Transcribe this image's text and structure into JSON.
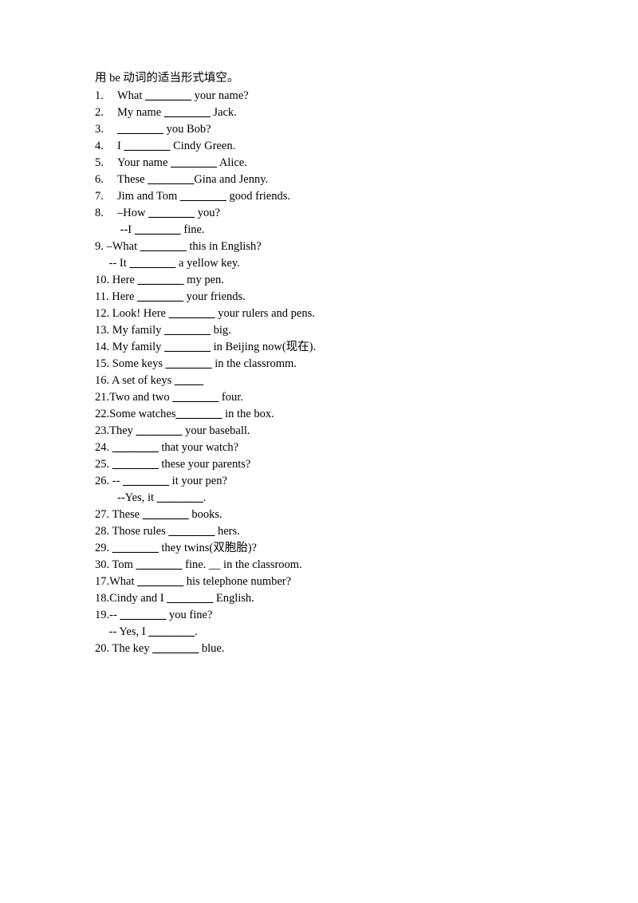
{
  "document": {
    "heading": "用 be 动词的适当形式填空。",
    "blank_long": "________",
    "blank_short": "_____",
    "blank_tiny": "__",
    "lines": [
      {
        "id": "q1",
        "style": "tabbed",
        "num": "1.",
        "before": "What ",
        "blank": "long",
        "after": " your name?"
      },
      {
        "id": "q2",
        "style": "tabbed",
        "num": "2.",
        "before": "My name ",
        "blank": "long",
        "after": " Jack."
      },
      {
        "id": "q3",
        "style": "tabbed",
        "num": "3.",
        "before": "",
        "blank": "long",
        "after": " you Bob?"
      },
      {
        "id": "q4",
        "style": "tabbed",
        "num": "4.",
        "before": "I ",
        "blank": "long",
        "after": " Cindy Green."
      },
      {
        "id": "q5",
        "style": "tabbed",
        "num": "5.",
        "before": "Your name ",
        "blank": "long",
        "after": " Alice."
      },
      {
        "id": "q6",
        "style": "tabbed",
        "num": "6.",
        "before": "These ",
        "blank": "long",
        "after": "Gina and Jenny."
      },
      {
        "id": "q7",
        "style": "tabbed",
        "num": "7.",
        "before": "Jim and Tom ",
        "blank": "long",
        "after": " good friends."
      },
      {
        "id": "q8",
        "style": "tabbed",
        "num": "8.",
        "before": "–How ",
        "blank": "long",
        "after": " you?"
      },
      {
        "id": "q8a",
        "style": "cont",
        "num": "",
        "before": " --I ",
        "blank": "long",
        "after": " fine."
      },
      {
        "id": "q9",
        "style": "plain",
        "num": "9.",
        "before": " –What ",
        "blank": "long",
        "after": " this in English?"
      },
      {
        "id": "q9a",
        "style": "cont2",
        "num": "",
        "before": " -- It ",
        "blank": "long",
        "after": " a yellow key."
      },
      {
        "id": "q10",
        "style": "plain",
        "num": "10.",
        "before": " Here ",
        "blank": "long",
        "after": " my pen."
      },
      {
        "id": "q11",
        "style": "plain",
        "num": "11.",
        "before": " Here ",
        "blank": "long",
        "after": " your friends."
      },
      {
        "id": "q12",
        "style": "plain",
        "num": "12.",
        "before": " Look! Here ",
        "blank": "long",
        "after": " your rulers and pens."
      },
      {
        "id": "q13",
        "style": "plain",
        "num": "13.",
        "before": " My family ",
        "blank": "long",
        "after": " big."
      },
      {
        "id": "q14",
        "style": "plain",
        "num": "14.",
        "before": " My family ",
        "blank": "long",
        "after": " in Beijing now(现在)."
      },
      {
        "id": "q15",
        "style": "plain",
        "num": "15.",
        "before": " Some keys ",
        "blank": "long",
        "after": " in the classromm."
      },
      {
        "id": "q16",
        "style": "plain",
        "num": "16.",
        "before": " A set of keys ",
        "blank": "short",
        "after": ""
      },
      {
        "id": "q21",
        "style": "plain",
        "num": "21.",
        "before": "Two and two ",
        "blank": "long",
        "after": " four."
      },
      {
        "id": "q22",
        "style": "plain",
        "num": "22.",
        "before": "Some watches",
        "blank": "long",
        "after": " in the box."
      },
      {
        "id": "q23",
        "style": "plain",
        "num": "23.",
        "before": "They ",
        "blank": "long",
        "after": " your baseball."
      },
      {
        "id": "q24",
        "style": "plain",
        "num": "24.",
        "before": " ",
        "blank": "long",
        "after": " that your watch?"
      },
      {
        "id": "q25",
        "style": "plain",
        "num": "25.",
        "before": " ",
        "blank": "long",
        "after": " these your parents?"
      },
      {
        "id": "q26",
        "style": "plain",
        "num": "26.",
        "before": " -- ",
        "blank": "long",
        "after": " it your pen?"
      },
      {
        "id": "q26a",
        "style": "cont",
        "num": "",
        "before": "--Yes, it ",
        "blank": "long",
        "after": "."
      },
      {
        "id": "q27",
        "style": "plain",
        "num": "27.",
        "before": " These ",
        "blank": "long",
        "after": " books."
      },
      {
        "id": "q28",
        "style": "plain",
        "num": "28.",
        "before": " Those rules ",
        "blank": "long",
        "after": " hers."
      },
      {
        "id": "q29",
        "style": "plain",
        "num": "29.",
        "before": " ",
        "blank": "long",
        "after": " they twins(双胞胎)?"
      },
      {
        "id": "q30",
        "style": "plain",
        "num": "30.",
        "before": " Tom ",
        "blank": "long",
        "after": " fine. __ in the classroom."
      },
      {
        "id": "q17",
        "style": "plain",
        "num": "17.",
        "before": "What ",
        "blank": "long",
        "after": " his telephone number?"
      },
      {
        "id": "q18",
        "style": "plain",
        "num": "18.",
        "before": "Cindy and I ",
        "blank": "long",
        "after": " English."
      },
      {
        "id": "q19",
        "style": "plain",
        "num": "19.",
        "before": "-- ",
        "blank": "long",
        "after": " you fine?"
      },
      {
        "id": "q19a",
        "style": "cont2",
        "num": "",
        "before": " -- Yes, I ",
        "blank": "long",
        "after": "."
      },
      {
        "id": "q20",
        "style": "plain",
        "num": "20.",
        "before": " The key ",
        "blank": "long",
        "after": " blue."
      }
    ]
  }
}
